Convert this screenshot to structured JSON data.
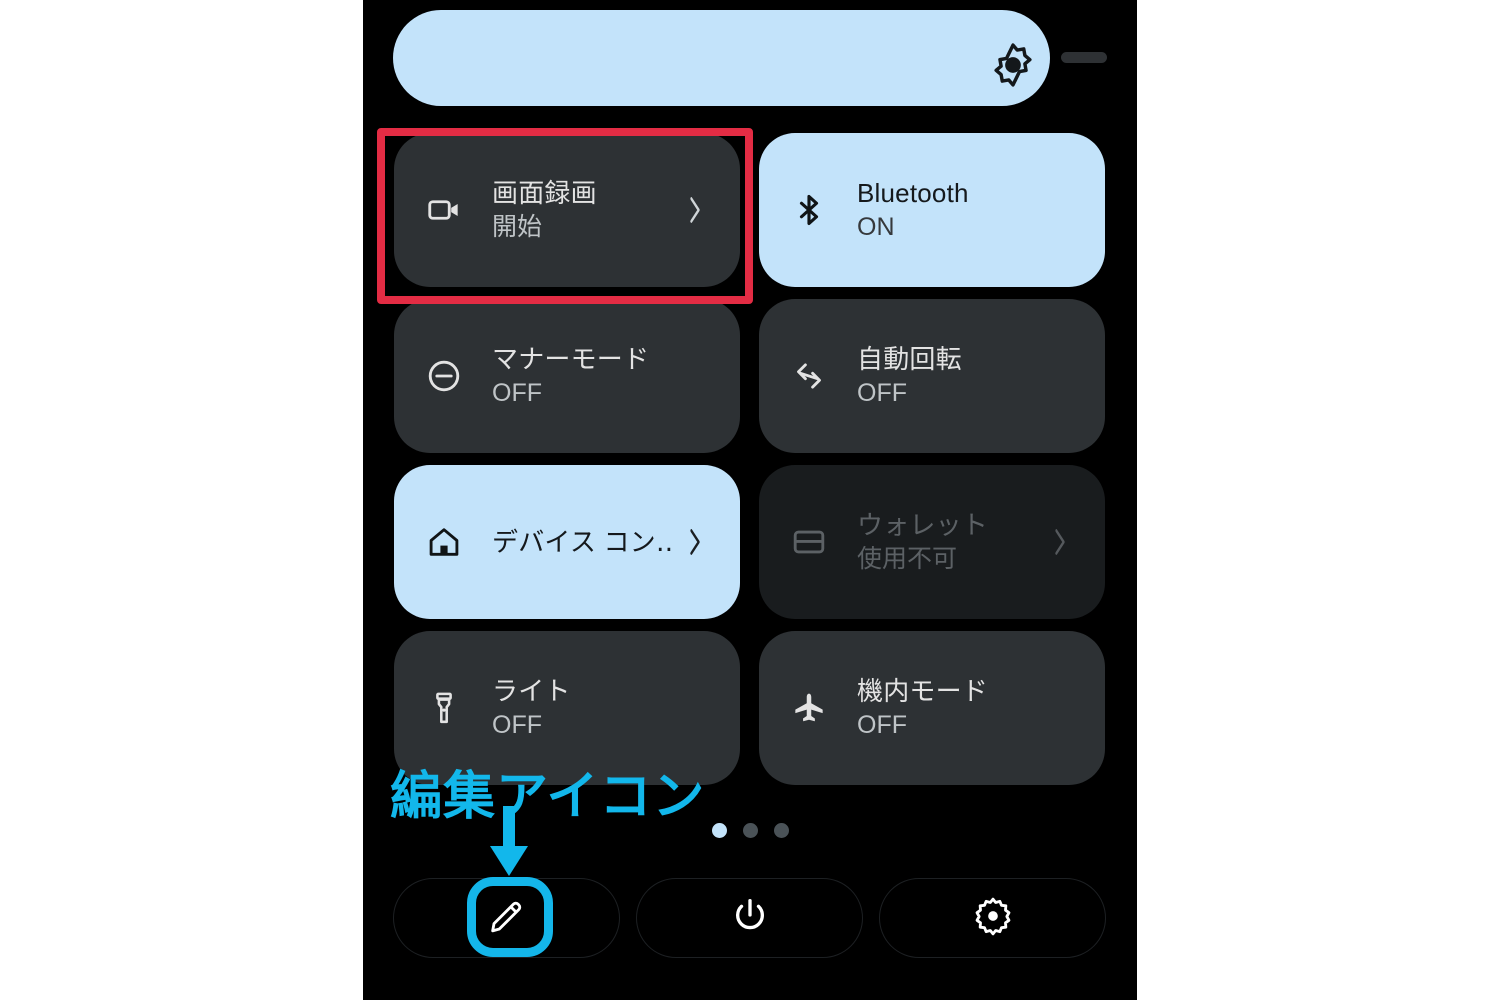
{
  "screen": {
    "background": "#000000",
    "accent_on": "#c3e3fa",
    "tile_off": "#2d3134",
    "tile_disabled": "#191c1e"
  },
  "brightness": {
    "name": "brightness-slider",
    "icon": "brightness-icon",
    "value_percent": 92
  },
  "tiles": [
    {
      "id": "screen-record",
      "icon": "videocam-icon",
      "title": "画面録画",
      "subtitle": "開始",
      "state": "off",
      "chevron": true,
      "layout": "two-line"
    },
    {
      "id": "bluetooth",
      "icon": "bluetooth-icon",
      "title": "Bluetooth",
      "subtitle": "ON",
      "state": "on",
      "chevron": false,
      "layout": "two-line"
    },
    {
      "id": "dnd",
      "icon": "do-not-disturb-icon",
      "title": "マナーモード",
      "subtitle": "OFF",
      "state": "off",
      "chevron": false,
      "layout": "two-line"
    },
    {
      "id": "auto-rotate",
      "icon": "auto-rotate-icon",
      "title": "自動回転",
      "subtitle": "OFF",
      "state": "off",
      "chevron": false,
      "layout": "two-line"
    },
    {
      "id": "device-controls",
      "icon": "home-icon",
      "title": "デバイス コン‥",
      "subtitle": "",
      "state": "on",
      "chevron": true,
      "layout": "single-line"
    },
    {
      "id": "wallet",
      "icon": "wallet-icon",
      "title": "ウォレット",
      "subtitle": "使用不可",
      "state": "disabled",
      "chevron": true,
      "layout": "two-line"
    },
    {
      "id": "flashlight",
      "icon": "flashlight-icon",
      "title": "ライト",
      "subtitle": "OFF",
      "state": "off",
      "chevron": false,
      "layout": "two-line"
    },
    {
      "id": "airplane",
      "icon": "airplane-icon",
      "title": "機内モード",
      "subtitle": "OFF",
      "state": "off",
      "chevron": false,
      "layout": "two-line"
    }
  ],
  "pager": {
    "total": 3,
    "active_index": 0
  },
  "footer": [
    {
      "id": "edit",
      "icon": "pencil-icon",
      "label": ""
    },
    {
      "id": "power",
      "icon": "power-icon",
      "label": ""
    },
    {
      "id": "settings",
      "icon": "gear-icon",
      "label": ""
    }
  ],
  "annotations": {
    "red_box_target": "screen-record",
    "red_box_color": "#e32c44",
    "cyan_color": "#12b7eb",
    "label_text": "編集アイコン",
    "arrow": "down-arrow-icon",
    "cyan_box_target": "edit"
  }
}
